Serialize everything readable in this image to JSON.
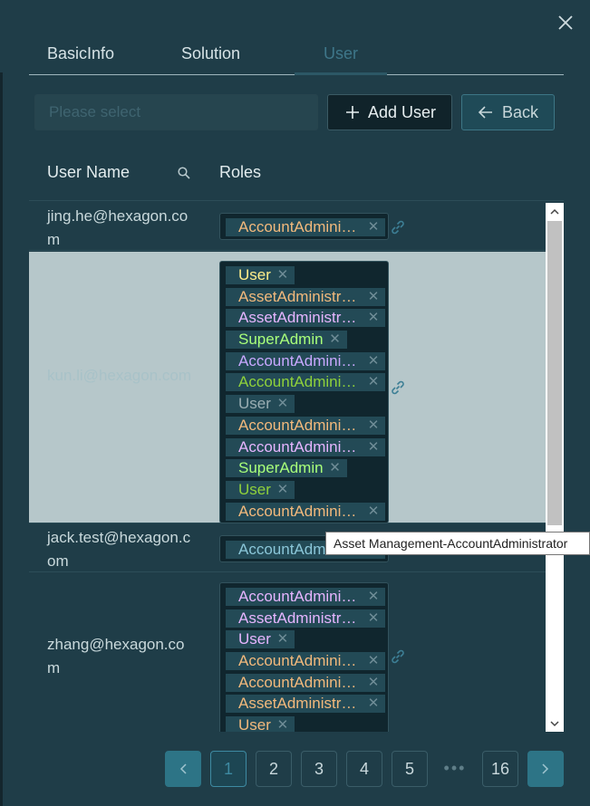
{
  "tabs": [
    {
      "label": "BasicInfo"
    },
    {
      "label": "Solution"
    },
    {
      "label": "User"
    }
  ],
  "toolbar": {
    "select_placeholder": "Please select",
    "add_user_label": "Add User",
    "back_label": "Back"
  },
  "table": {
    "headers": {
      "user_name": "User Name",
      "roles": "Roles"
    },
    "rows": [
      {
        "user": "jing.he@hexagon.com",
        "roles": [
          {
            "label": "AccountAdministrator",
            "color": "#f2b97c"
          }
        ]
      },
      {
        "user": "kun.li@hexagon.com",
        "selected": true,
        "roles": [
          {
            "label": "User",
            "color": "#ffee8a"
          },
          {
            "label": "AssetAdministrator",
            "color": "#f2b97c"
          },
          {
            "label": "AssetAdministrator",
            "color": "#e6b5ff"
          },
          {
            "label": "SuperAdmin",
            "color": "#a8ff7a"
          },
          {
            "label": "AccountAdministrator",
            "color": "#c8a8ff"
          },
          {
            "label": "AccountAdministrator",
            "color": "#8fd13b"
          },
          {
            "label": "User",
            "color": "#9aaeb3"
          },
          {
            "label": "AccountAdministrator",
            "color": "#f2b97c"
          },
          {
            "label": "AccountAdministrator",
            "color": "#e6b5ff"
          },
          {
            "label": "SuperAdmin",
            "color": "#a8ff7a"
          },
          {
            "label": "User",
            "color": "#8fd13b"
          },
          {
            "label": "AccountAdministrator",
            "color": "#f2b97c"
          }
        ]
      },
      {
        "user": "jack.test@hexagon.com",
        "roles": [
          {
            "label": "AccountAdministrator",
            "color": "#8ac6d8"
          }
        ]
      },
      {
        "user": "zhang@hexagon.com",
        "roles": [
          {
            "label": "AccountAdministrator",
            "color": "#e6b5ff"
          },
          {
            "label": "AssetAdministrator",
            "color": "#e6b5ff"
          },
          {
            "label": "User",
            "color": "#e6b5ff"
          },
          {
            "label": "AccountAdministrator",
            "color": "#f2b97c"
          },
          {
            "label": "AccountAdministrator",
            "color": "#f2b97c"
          },
          {
            "label": "AssetAdministrator",
            "color": "#f2b97c"
          },
          {
            "label": "User",
            "color": "#f2b97c"
          }
        ]
      }
    ]
  },
  "tooltip": "Asset Management-AccountAdministrator",
  "pagination": {
    "pages": [
      "1",
      "2",
      "3",
      "4",
      "5"
    ],
    "ellipsis": "•••",
    "last": "16",
    "current": "1"
  },
  "colors": {
    "background": "#1f3d48",
    "accent": "#3e8aa2",
    "selected_row": "#b6c7ca"
  },
  "icons": [
    "close-icon",
    "plus-icon",
    "arrow-left-icon",
    "search-icon",
    "link-icon",
    "chevron-left-icon",
    "chevron-right-icon",
    "scroll-up-icon",
    "scroll-down-icon"
  ]
}
